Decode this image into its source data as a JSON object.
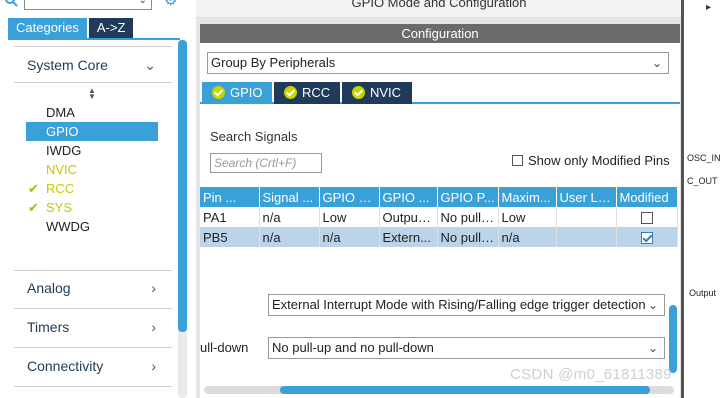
{
  "left_panel": {
    "tabs": {
      "categories": "Categories",
      "az": "A->Z"
    },
    "system_core": {
      "title": "System Core",
      "items": [
        {
          "label": "DMA",
          "state": "normal"
        },
        {
          "label": "GPIO",
          "state": "selected"
        },
        {
          "label": "IWDG",
          "state": "normal"
        },
        {
          "label": "NVIC",
          "state": "yellow"
        },
        {
          "label": "RCC",
          "state": "checked"
        },
        {
          "label": "SYS",
          "state": "checked"
        },
        {
          "label": "WWDG",
          "state": "normal"
        }
      ]
    },
    "categories": [
      "Analog",
      "Timers",
      "Connectivity"
    ]
  },
  "main": {
    "title": "GPIO Mode and Configuration",
    "config_header": "Configuration",
    "group_by": "Group By Peripherals",
    "peripheral_tabs": [
      "GPIO",
      "RCC",
      "NVIC"
    ],
    "search": {
      "label": "Search Signals",
      "placeholder": "Search (Crtl+F)"
    },
    "show_modified": "Show only Modified Pins",
    "table": {
      "headers": [
        "Pin ...",
        "Signal ...",
        "GPIO o...",
        "GPIO ...",
        "GPIO P...",
        "Maxim...",
        "User La...",
        "Modified"
      ],
      "rows": [
        {
          "cells": [
            "PA1",
            "n/a",
            "Low",
            "Output ...",
            "No pull-...",
            "Low",
            ""
          ],
          "modified": false,
          "selected": false
        },
        {
          "cells": [
            "PB5",
            "n/a",
            "n/a",
            "Extern...",
            "No pull-...",
            "n/a",
            ""
          ],
          "modified": true,
          "selected": true
        }
      ]
    },
    "mode_select": "External Interrupt Mode with Rising/Falling edge trigger detection",
    "pull_label": "ull-down",
    "pull_select": "No pull-up and no pull-down"
  },
  "right_strip": {
    "labels": [
      "OSC_IN",
      "C_OUT",
      "Output"
    ]
  },
  "watermark": "CSDN @m0_61811389"
}
